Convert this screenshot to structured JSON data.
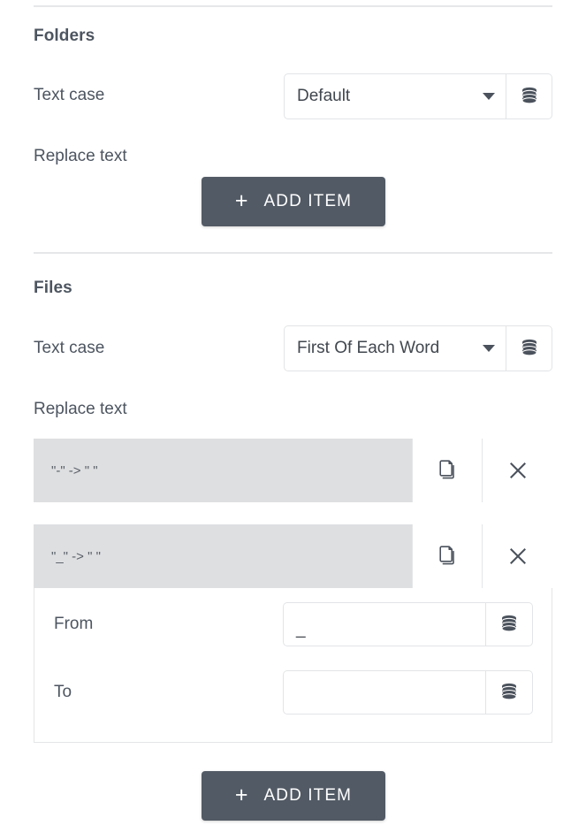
{
  "sections": [
    {
      "id": "folders",
      "heading": "Folders",
      "text_case": {
        "label": "Text case",
        "value": "Default",
        "db_icon": "database-icon",
        "caret_icon": "chevron-down-icon"
      },
      "replace_text": {
        "label": "Replace text",
        "items": []
      },
      "add_item": {
        "label": "ADD ITEM",
        "plus_icon": "plus-icon"
      }
    },
    {
      "id": "files",
      "heading": "Files",
      "text_case": {
        "label": "Text case",
        "value": "First Of Each Word",
        "db_icon": "database-icon",
        "caret_icon": "chevron-down-icon"
      },
      "replace_text": {
        "label": "Replace text",
        "items": [
          {
            "summary": "\"-\" -> \" \"",
            "expanded": false,
            "copy_icon": "copy-icon",
            "delete_icon": "close-icon"
          },
          {
            "summary": "\"_\" -> \" \"",
            "expanded": true,
            "copy_icon": "copy-icon",
            "delete_icon": "close-icon",
            "fields": {
              "from_label": "From",
              "from_value": "_",
              "from_placeholder": "",
              "to_label": "To",
              "to_value": "",
              "to_placeholder": "",
              "db_icon": "database-icon"
            }
          }
        ]
      },
      "add_item": {
        "label": "ADD ITEM",
        "plus_icon": "plus-icon"
      }
    }
  ],
  "colors": {
    "text": "#4d5560",
    "button_bg": "#525a65",
    "row_bg": "#dedfe1",
    "border": "#e2e4e7",
    "divider": "#e6e7e9",
    "page_bg": "#ffffff"
  }
}
